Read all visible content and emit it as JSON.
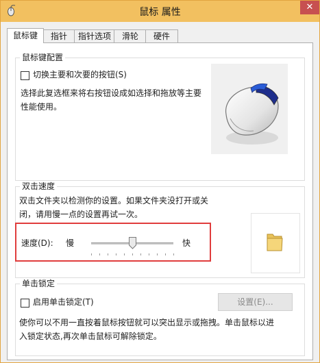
{
  "window": {
    "title": "鼠标 属性",
    "close_label": "✕"
  },
  "tabs": [
    {
      "label": "鼠标键"
    },
    {
      "label": "指针"
    },
    {
      "label": "指针选项"
    },
    {
      "label": "滑轮"
    },
    {
      "label": "硬件"
    }
  ],
  "button_config": {
    "group_label": "鼠标键配置",
    "switch_checkbox_label": "切换主要和次要的按钮(S)",
    "switch_checked": false,
    "description_line1": "选择此复选框来将右按钮设成如选择和拖放等主要",
    "description_line2": "性能使用。"
  },
  "double_click": {
    "group_label": "双击速度",
    "description_line1": "双击文件夹以检测你的设置。如果文件夹没打开或关",
    "description_line2": "闭，请用慢一点的设置再试一次。",
    "speed_label": "速度(D):",
    "slow_label": "慢",
    "fast_label": "快",
    "speed_value_fraction": 0.5
  },
  "click_lock": {
    "group_label": "单击锁定",
    "checkbox_label": "启用单击锁定(T)",
    "checked": false,
    "settings_button_label": "设置(E)...",
    "description_line1": "使你可以不用一直按着鼠标按钮就可以突出显示或拖拽。单击鼠标以进",
    "description_line2": "入锁定状态,再次单击鼠标可解除锁定。"
  },
  "colors": {
    "titlebar": "#f2c060",
    "highlight_border": "#e03c3c",
    "mouse_accent": "#2a5cd6"
  },
  "icons": {
    "app": "mouse-icon",
    "folder": "folder-icon"
  }
}
